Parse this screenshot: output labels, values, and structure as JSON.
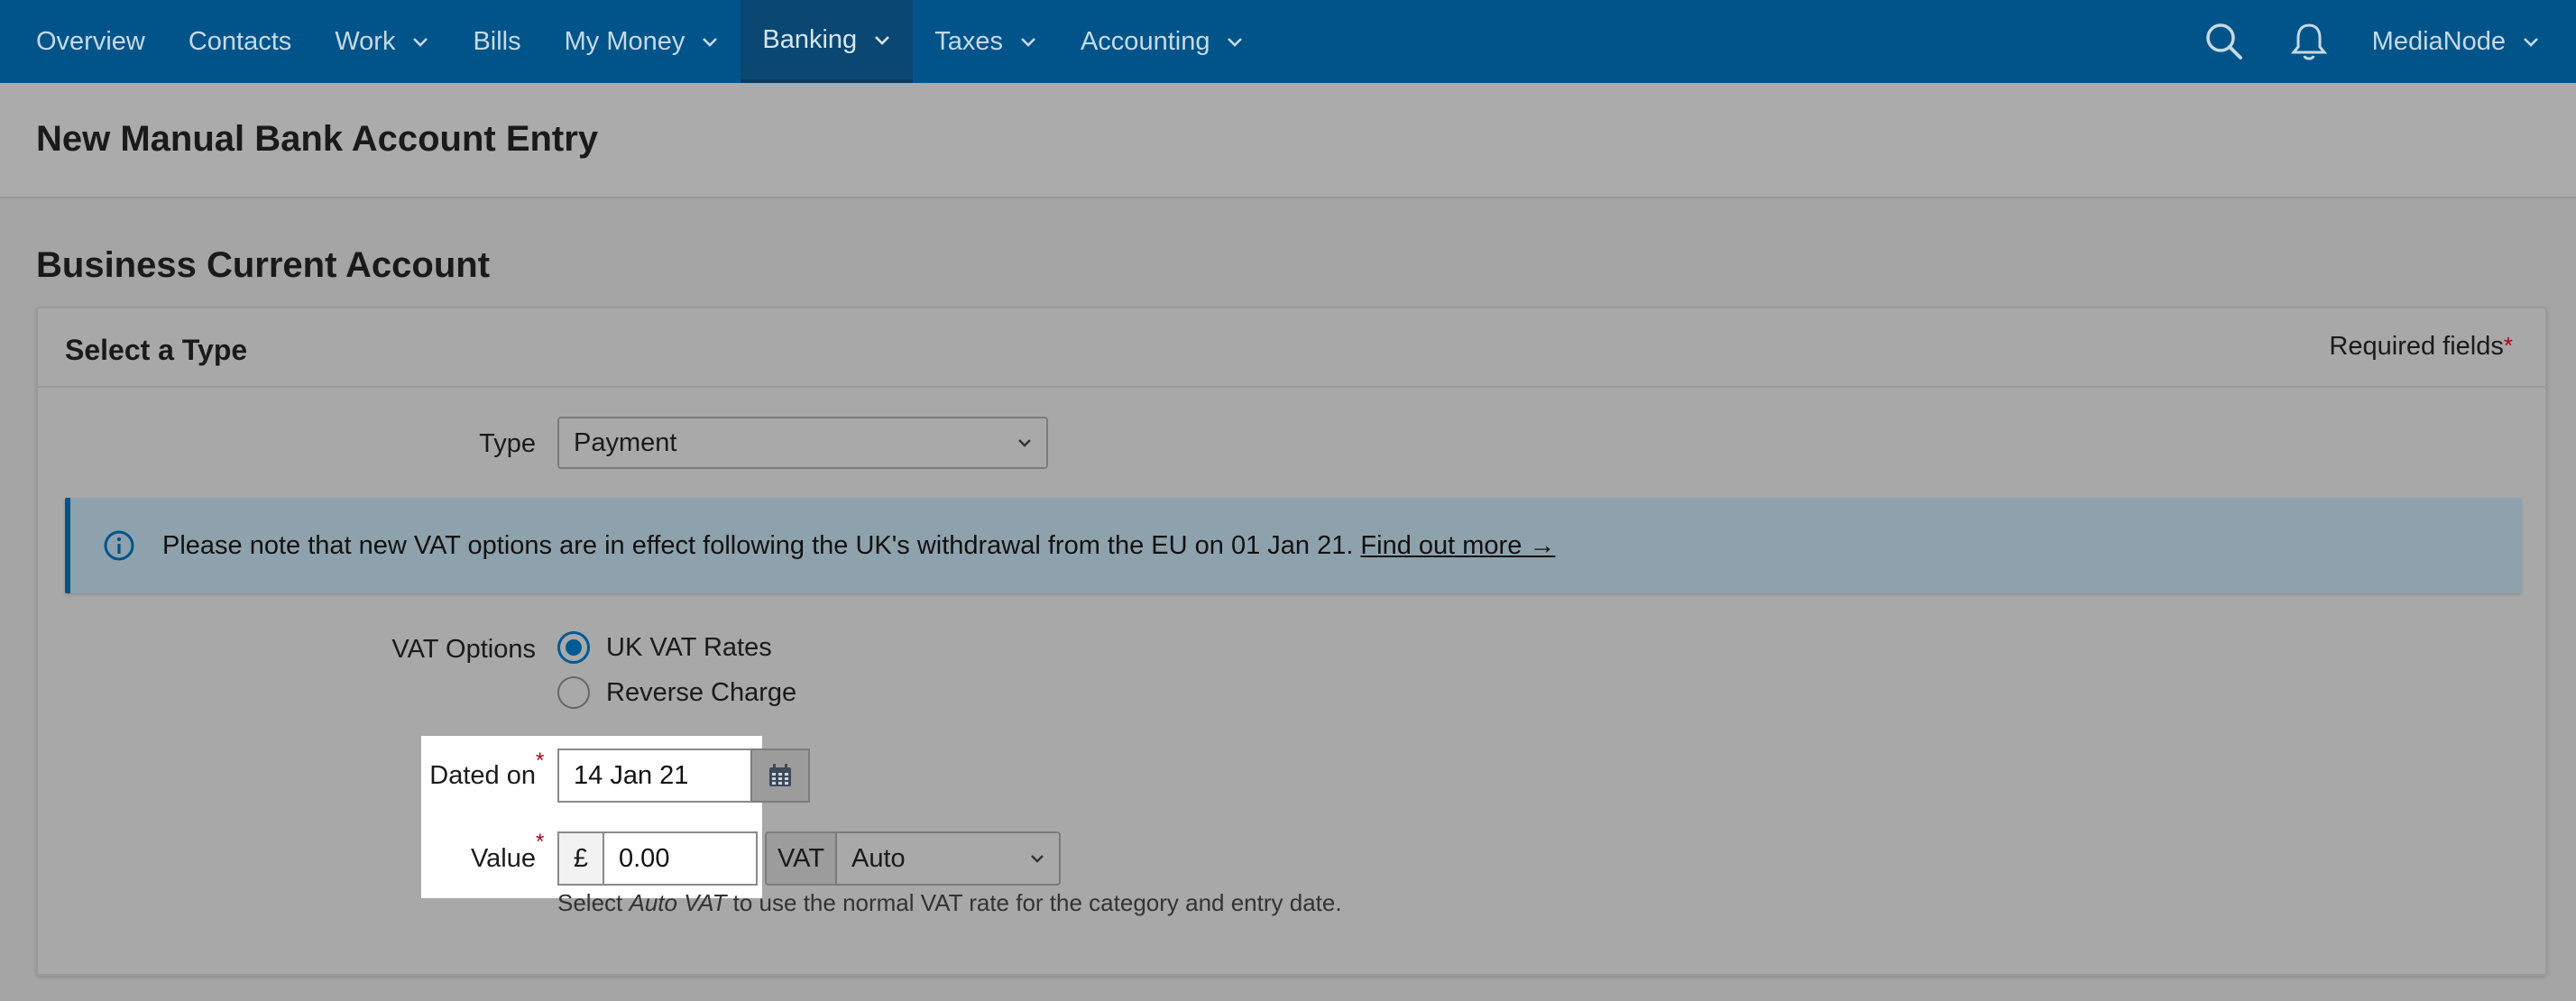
{
  "nav": {
    "items": [
      {
        "label": "Overview",
        "has_menu": false
      },
      {
        "label": "Contacts",
        "has_menu": false
      },
      {
        "label": "Work",
        "has_menu": true
      },
      {
        "label": "Bills",
        "has_menu": false
      },
      {
        "label": "My Money",
        "has_menu": true
      },
      {
        "label": "Banking",
        "has_menu": true,
        "active": true
      },
      {
        "label": "Taxes",
        "has_menu": true
      },
      {
        "label": "Accounting",
        "has_menu": true
      }
    ],
    "icons": [
      "search-icon",
      "bell-icon"
    ],
    "account_name": "MediaNode"
  },
  "page": {
    "title": "New Manual Bank Account Entry",
    "section_title": "Business Current Account"
  },
  "card": {
    "title": "Select a Type",
    "required_note": "Required fields",
    "required_star": "*"
  },
  "form": {
    "type_label": "Type",
    "type_value": "Payment",
    "info_banner": {
      "text": "Please note that new VAT options are in effect following the UK's withdrawal from the EU on 01 Jan 21.",
      "link": "Find out more →"
    },
    "vat_options_label": "VAT Options",
    "vat_options": [
      {
        "label": "UK VAT Rates",
        "checked": true
      },
      {
        "label": "Reverse Charge",
        "checked": false
      }
    ],
    "dated_on_label": "Dated on",
    "dated_on_value": "14 Jan 21",
    "value_label": "Value",
    "currency_symbol": "£",
    "value_amount": "0.00",
    "vat_addon": "VAT",
    "vat_select_value": "Auto",
    "help_prefix": "Select ",
    "help_em": "Auto VAT",
    "help_suffix": " to use the normal VAT rate for the category and entry date."
  },
  "colors": {
    "nav_bg": "#00548a",
    "accent": "#005a94",
    "required": "#b00018"
  }
}
